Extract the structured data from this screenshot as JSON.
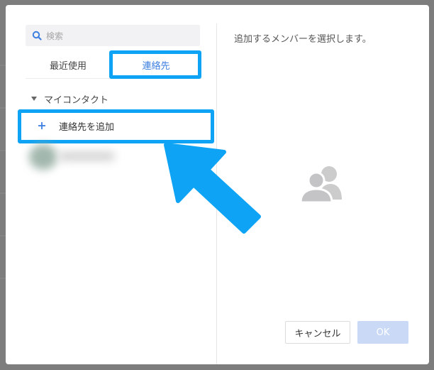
{
  "search": {
    "placeholder": "検索"
  },
  "tabs": [
    {
      "label": "最近使用",
      "active": false
    },
    {
      "label": "連絡先",
      "active": true
    }
  ],
  "contacts": {
    "group_label": "マイコンタクト",
    "add_label": "連絡先を追加"
  },
  "right_panel": {
    "instruction": "追加するメンバーを選択します。"
  },
  "buttons": {
    "cancel": "キャンセル",
    "ok": "OK"
  },
  "colors": {
    "highlight": "#0ea3f5",
    "tab_active": "#3d7fe0",
    "ok_disabled": "#c9d9f6"
  }
}
